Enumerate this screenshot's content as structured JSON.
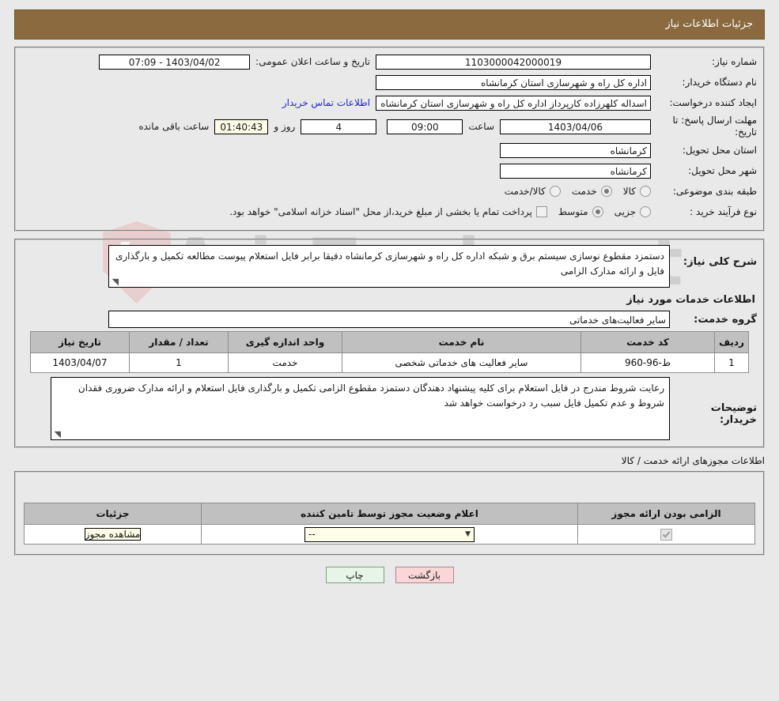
{
  "header": {
    "title": "جزئیات اطلاعات نیاز"
  },
  "watermark": {
    "text": "AriaTender.net"
  },
  "info": {
    "need_number_label": "شماره نیاز:",
    "need_number_value": "1103000042000019",
    "announce_label": "تاریخ و ساعت اعلان عمومی:",
    "announce_value": "1403/04/02 - 07:09",
    "buyer_org_label": "نام دستگاه خریدار:",
    "buyer_org_value": "اداره کل راه و شهرسازی استان کرمانشاه",
    "requester_label": "ایجاد کننده درخواست:",
    "requester_value": "اسداله کلهرزاده کارپرداز اداره کل راه و شهرسازی استان کرمانشاه",
    "contact_link": "اطلاعات تماس خریدار",
    "deadline_label": "مهلت ارسال پاسخ: تا تاریخ:",
    "deadline_date": "1403/04/06",
    "hour_label": "ساعت",
    "deadline_time": "09:00",
    "days_value": "4",
    "days_label": "روز و",
    "countdown_value": "01:40:43",
    "remaining_label": "ساعت باقی مانده",
    "province_label": "استان محل تحویل:",
    "province_value": "کرمانشاه",
    "city_label": "شهر محل تحویل:",
    "city_value": "کرمانشاه",
    "category_label": "طبقه بندی موضوعی:",
    "category_options": [
      {
        "label": "کالا",
        "selected": false
      },
      {
        "label": "خدمت",
        "selected": true
      },
      {
        "label": "کالا/خدمت",
        "selected": false
      }
    ],
    "process_label": "نوع فرآیند خرید :",
    "process_options": [
      {
        "label": "جزیی",
        "selected": false
      },
      {
        "label": "متوسط",
        "selected": true
      }
    ],
    "payment_note": "پرداخت تمام یا بخشی از مبلغ خرید،از محل \"اسناد خزانه اسلامی\" خواهد بود."
  },
  "description": {
    "label": "شرح کلی نیاز:",
    "value": "دستمزد مقطوع نوسازی سیستم برق و شبکه اداره کل راه و شهرسازی کرمانشاه دقیقا برابر فایل استعلام پیوست مطالعه تکمیل و بارگذاری فایل و ارائه مدارک الزامی",
    "grip": "◥"
  },
  "services": {
    "section_title": "اطلاعات خدمات مورد نیاز",
    "group_label": "گروه خدمت:",
    "group_value": "سایر فعالیت‌های خدماتی",
    "columns": [
      "ردیف",
      "کد خدمت",
      "نام خدمت",
      "واحد اندازه گیری",
      "تعداد / مقدار",
      "تاریخ نیاز"
    ],
    "rows": [
      {
        "row": "1",
        "code": "ط-96-960",
        "name": "سایر فعالیت های خدماتی شخصی",
        "unit": "خدمت",
        "qty": "1",
        "need_date": "1403/04/07"
      }
    ]
  },
  "buyer_notes": {
    "label": "توضیحات خریدار:",
    "value": "رعایت شروط مندرج در فایل استعلام برای کلیه پیشنهاد دهندگان دستمزد مقطوع الزامی تکمیل و بارگذاری فایل استعلام و ارائه مدارک ضروری فقدان شروط و عدم تکمیل فایل سبب رد درخواست خواهد شد",
    "grip": "◥"
  },
  "permits": {
    "section_title": "اطلاعات مجوزهای ارائه خدمت / کالا",
    "columns": [
      "الزامی بودن ارائه مجوز",
      "اعلام وضعیت مجوز توسط تامین کننده",
      "جزئیات"
    ],
    "rows": [
      {
        "required_checked": true,
        "status_value": "--",
        "details_button": "مشاهده مجوز"
      }
    ]
  },
  "footer": {
    "print_label": "چاپ",
    "back_label": "بازگشت"
  }
}
